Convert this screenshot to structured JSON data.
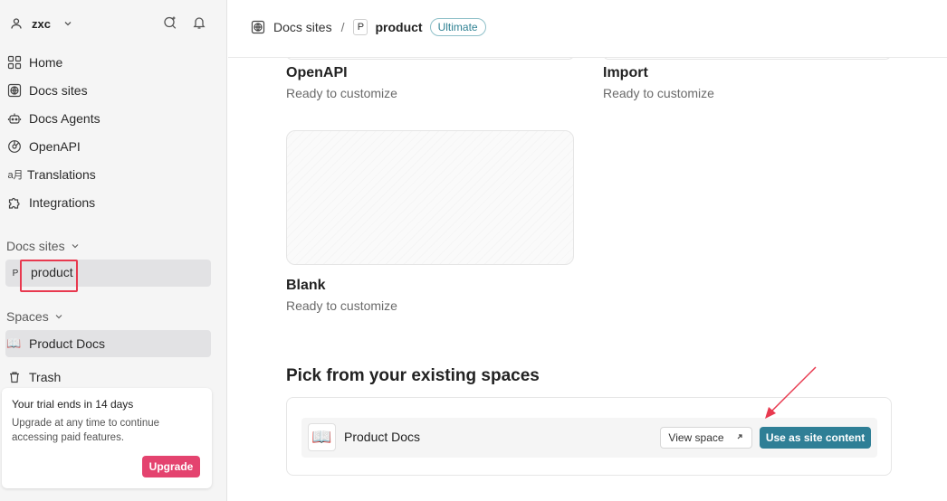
{
  "sidebar": {
    "user": {
      "name": "zxc"
    },
    "nav": [
      {
        "label": "Home",
        "icon": "home-icon"
      },
      {
        "label": "Docs sites",
        "icon": "globe-icon"
      },
      {
        "label": "Docs Agents",
        "icon": "agent-icon"
      },
      {
        "label": "OpenAPI",
        "icon": "openapi-icon"
      },
      {
        "label": "Translations",
        "icon": "translate-icon"
      },
      {
        "label": "Integrations",
        "icon": "puzzle-icon"
      }
    ],
    "docs_sites_heading": "Docs sites",
    "docs_sites": [
      {
        "badge": "P",
        "label": "product"
      }
    ],
    "spaces_heading": "Spaces",
    "spaces": [
      {
        "label": "Product Docs",
        "icon": "book-icon"
      },
      {
        "label": "Trash",
        "icon": "trash-icon"
      }
    ],
    "trial": {
      "title": "Your trial ends in 14 days",
      "text": "Upgrade at any time to continue accessing paid features.",
      "button": "Upgrade"
    }
  },
  "header": {
    "breadcrumb_root": "Docs sites",
    "separator": "/",
    "site_badge": "P",
    "site_name": "product",
    "plan_tag": "Ultimate"
  },
  "main": {
    "options": [
      {
        "title": "OpenAPI",
        "subtitle": "Ready to customize"
      },
      {
        "title": "Import",
        "subtitle": "Ready to customize"
      },
      {
        "title": "Blank",
        "subtitle": "Ready to customize"
      }
    ],
    "existing_heading": "Pick from your existing spaces",
    "space_row": {
      "name": "Product Docs",
      "view_label": "View space",
      "use_label": "Use as site content"
    }
  },
  "colors": {
    "accent": "#2f7f96",
    "upgrade": "#e4436f",
    "annotation": "#e8394f"
  }
}
